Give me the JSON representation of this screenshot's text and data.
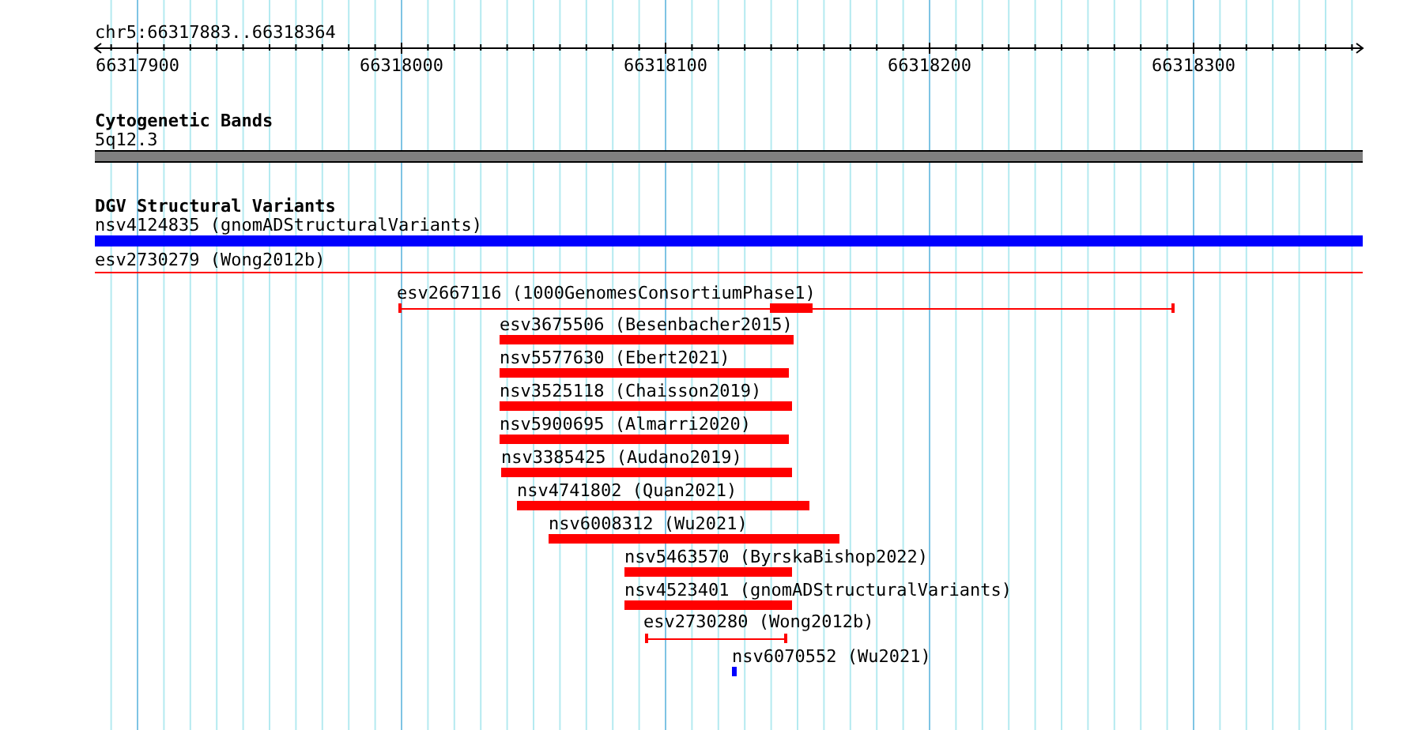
{
  "location": "chr5:66317883..66318364",
  "ruler": {
    "ticks": [
      "66317900",
      "66318000",
      "66318100",
      "66318200",
      "66318300"
    ]
  },
  "tracks": [
    {
      "kind": "cytoband",
      "title": "Cytogenetic Bands",
      "features": [
        {
          "label": "5q12.3"
        }
      ]
    },
    {
      "kind": "variants",
      "title": "DGV Structural Variants",
      "features": [
        {
          "label": "nsv4124835 (gnomADStructuralVariants)",
          "kind": "bar",
          "color": "#0000ff"
        },
        {
          "label": "esv2730279 (Wong2012b)",
          "kind": "line",
          "color": "#ff0000"
        },
        {
          "label": "esv2667116 (1000GenomesConsortiumPhase1)",
          "kind": "split",
          "color": "#ff0000"
        },
        {
          "label": "esv3675506 (Besenbacher2015)",
          "kind": "bar",
          "color": "#ff0000"
        },
        {
          "label": "nsv5577630 (Ebert2021)",
          "kind": "bar",
          "color": "#ff0000"
        },
        {
          "label": "nsv3525118 (Chaisson2019)",
          "kind": "bar",
          "color": "#ff0000"
        },
        {
          "label": "nsv5900695 (Almarri2020)",
          "kind": "bar",
          "color": "#ff0000"
        },
        {
          "label": "nsv3385425 (Audano2019)",
          "kind": "bar",
          "color": "#ff0000"
        },
        {
          "label": "nsv4741802 (Quan2021)",
          "kind": "bar",
          "color": "#ff0000"
        },
        {
          "label": "nsv6008312 (Wu2021)",
          "kind": "bar",
          "color": "#ff0000"
        },
        {
          "label": "nsv5463570 (ByrskaBishop2022)",
          "kind": "bar",
          "color": "#ff0000"
        },
        {
          "label": "nsv4523401 (gnomADStructuralVariants)",
          "kind": "bar",
          "color": "#ff0000"
        },
        {
          "label": "esv2730280 (Wong2012b)",
          "kind": "split",
          "color": "#ff0000"
        },
        {
          "label": "nsv6070552 (Wu2021)",
          "kind": "bar",
          "color": "#0000ff"
        }
      ]
    }
  ]
}
